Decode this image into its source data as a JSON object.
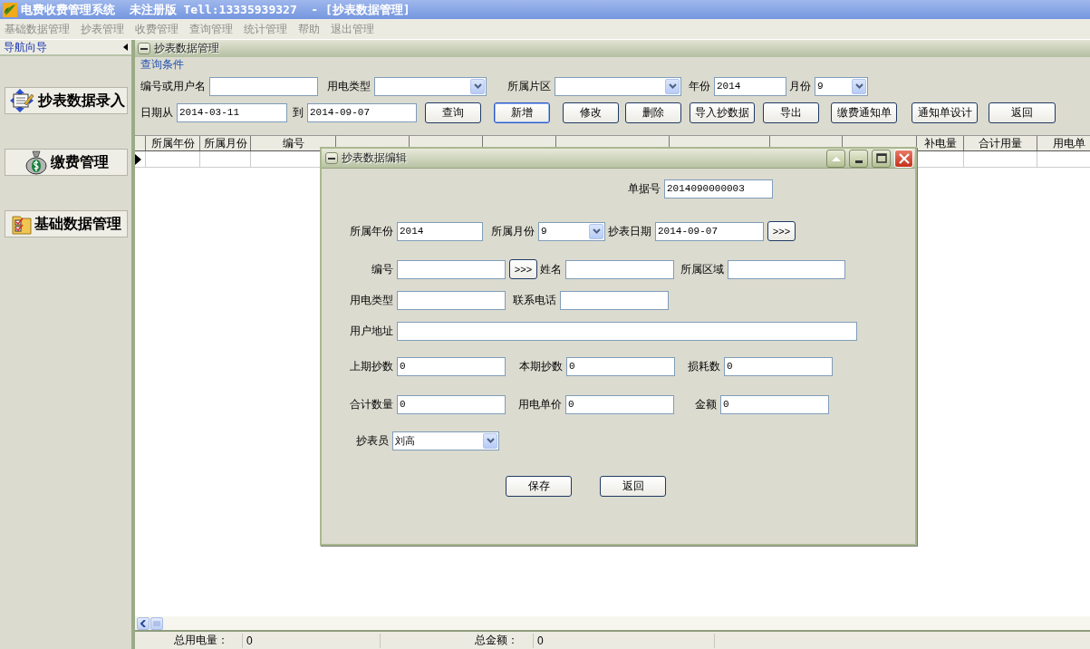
{
  "window": {
    "title": "电费收费管理系统  未注册版 Tell:13335939327  - [抄表数据管理]"
  },
  "menu": [
    "基础数据管理",
    "抄表管理",
    "收费管理",
    "查询管理",
    "统计管理",
    "帮助",
    "退出管理"
  ],
  "sidebar": {
    "title": "导航向导",
    "items": [
      {
        "label": "抄表数据录入"
      },
      {
        "label": "缴费管理"
      },
      {
        "label": "基础数据管理"
      }
    ]
  },
  "panel": {
    "title": "抄表数据管理",
    "query_legend": "查询条件",
    "filters": [
      {
        "label": "编号或用户名",
        "kind": "text"
      },
      {
        "label": "用电类型",
        "kind": "select"
      },
      {
        "label": "所属片区",
        "kind": "select"
      },
      {
        "label": "年份",
        "kind": "text",
        "value": "2014"
      },
      {
        "label": "月份",
        "kind": "select",
        "value": "9"
      }
    ],
    "dates": [
      {
        "label": "日期从",
        "value": "2014-03-11"
      },
      {
        "label": "到",
        "value": "2014-09-07"
      }
    ],
    "buttons": [
      {
        "label": "查询",
        "selected": false
      },
      {
        "label": "新增",
        "selected": true
      },
      {
        "label": "修改",
        "selected": false
      },
      {
        "label": "删除",
        "selected": false
      },
      {
        "label": "导入抄数据",
        "selected": false
      },
      {
        "label": "导出",
        "selected": false
      },
      {
        "label": "缴费通知单",
        "selected": false
      },
      {
        "label": "通知单设计",
        "selected": false
      },
      {
        "label": "返回",
        "selected": false
      }
    ]
  },
  "table": {
    "columns": [
      "所属年份",
      "所属月份",
      "编号",
      "补电量",
      "合计用量",
      "用电单"
    ]
  },
  "status_bar": [
    {
      "label": "总用电量：",
      "value": "0"
    },
    {
      "label": "总金额：",
      "value": "0"
    }
  ],
  "dialog": {
    "title": "抄表数据编辑",
    "fields": [
      {
        "label": "单据号",
        "kind": "text",
        "value": "2014090000003"
      },
      {
        "label": "所属年份",
        "kind": "text",
        "value": "2014"
      },
      {
        "label": "所属月份",
        "kind": "select",
        "value": "9"
      },
      {
        "label": "抄表日期",
        "kind": "text_button",
        "value": "2014-09-07",
        "button": ">>>"
      },
      {
        "label": "编号",
        "kind": "text_button",
        "button": ">>>"
      },
      {
        "label": "姓名",
        "kind": "text"
      },
      {
        "label": "所属区域",
        "kind": "text"
      },
      {
        "label": "用电类型",
        "kind": "text"
      },
      {
        "label": "联系电话",
        "kind": "text"
      },
      {
        "label": "用户地址",
        "kind": "text"
      },
      {
        "label": "上期抄数",
        "kind": "text",
        "value": "0"
      },
      {
        "label": "本期抄数",
        "kind": "text",
        "value": "0"
      },
      {
        "label": "损耗数",
        "kind": "text",
        "value": "0"
      },
      {
        "label": "合计数量",
        "kind": "text",
        "value": "0"
      },
      {
        "label": "用电单价",
        "kind": "text",
        "value": "0"
      },
      {
        "label": "金额",
        "kind": "text",
        "value": "0"
      },
      {
        "label": "抄表员",
        "kind": "select",
        "value": "刘高"
      }
    ],
    "buttons": [
      "保存",
      "返回"
    ]
  }
}
